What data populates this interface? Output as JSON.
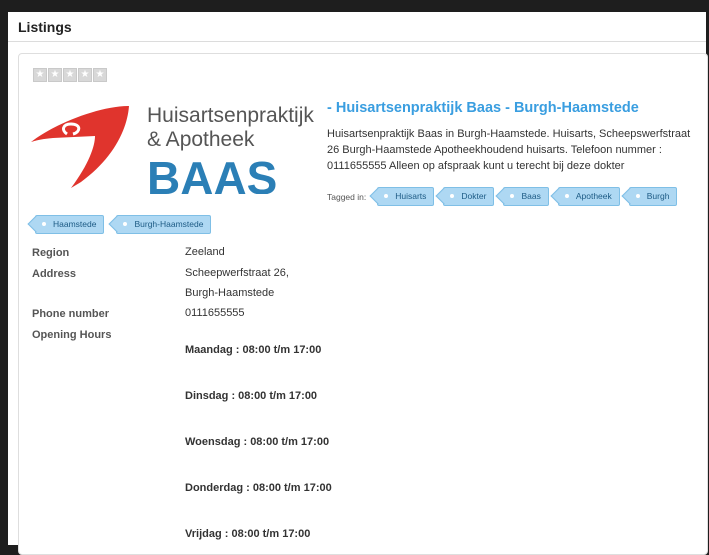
{
  "panel": {
    "title": "Listings"
  },
  "listing": {
    "rating": {
      "value": 0,
      "max": 5
    },
    "logo": {
      "line1": "Huisartsenpraktijk",
      "line2": "& Apotheek",
      "brand": "BAAS",
      "colors": {
        "red": "#e0342d",
        "blue": "#2b7fb6",
        "gray": "#555555"
      }
    },
    "title": "- Huisartsenpraktijk Baas - Burgh-Haamstede",
    "description": "Huisartsenpraktijk Baas in Burgh-Haamstede. Huisarts, Scheepswerfstraat 26 Burgh-Haamstede Apotheekhoudend huisarts. Telefoon nummer : 0111655555 Alleen op afspraak kunt u terecht bij deze dokter",
    "tagged_in_label": "Tagged in:",
    "tags": [
      "Huisarts",
      "Dokter",
      "Baas",
      "Apotheek",
      "Burgh",
      "Haamstede",
      "Burgh-Haamstede"
    ],
    "fields": {
      "region": {
        "label": "Region",
        "value": "Zeeland"
      },
      "address": {
        "label": "Address",
        "line1": "Scheepwerfstraat 26,",
        "line2": "Burgh-Haamstede"
      },
      "phone": {
        "label": "Phone number",
        "value": "0111655555"
      },
      "opening_hours": {
        "label": "Opening Hours",
        "days": [
          "Maandag : 08:00 t/m 17:00",
          "Dinsdag : 08:00 t/m 17:00",
          "Woensdag : 08:00 t/m 17:00",
          "Donderdag : 08:00 t/m 17:00",
          "Vrijdag : 08:00 t/m 17:00"
        ]
      }
    }
  },
  "colors": {
    "accent": "#3a9ee0",
    "tag_bg": "#aed8f3",
    "tag_border": "#7fbfe6"
  }
}
